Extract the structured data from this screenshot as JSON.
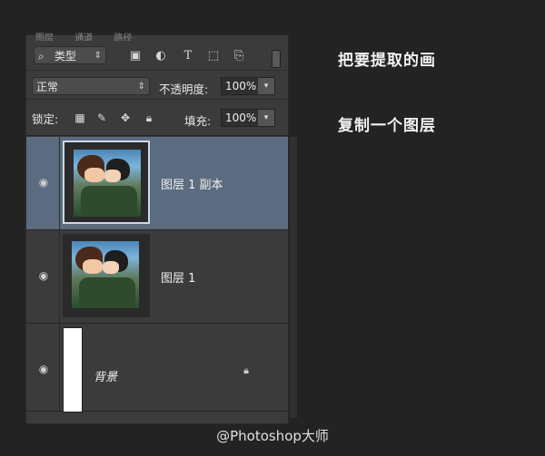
{
  "panel": {
    "tabs": [
      "图层",
      "通道",
      "路径"
    ],
    "filter": {
      "kind_label": "类型"
    },
    "blend": {
      "mode": "正常",
      "opacity_label": "不透明度:",
      "opacity": "100%"
    },
    "lock": {
      "label": "锁定:",
      "fill_label": "填充:",
      "fill": "100%"
    },
    "layers": [
      {
        "name": "图层 1 副本",
        "selected": true
      },
      {
        "name": "图层 1",
        "selected": false
      },
      {
        "name": "背景",
        "locked": true
      }
    ]
  },
  "annotations": {
    "line1": "把要提取的画",
    "line2": "复制一个图层"
  },
  "footer": {
    "watermark": "@Photoshop大师"
  },
  "icons": [
    "eye-icon",
    "lock-icon",
    "search-icon",
    "image-filter-icon",
    "adjustment-filter-icon",
    "type-filter-icon",
    "shape-filter-icon",
    "smart-object-filter-icon",
    "lock-transparent-icon",
    "lock-brush-icon",
    "lock-move-icon"
  ]
}
